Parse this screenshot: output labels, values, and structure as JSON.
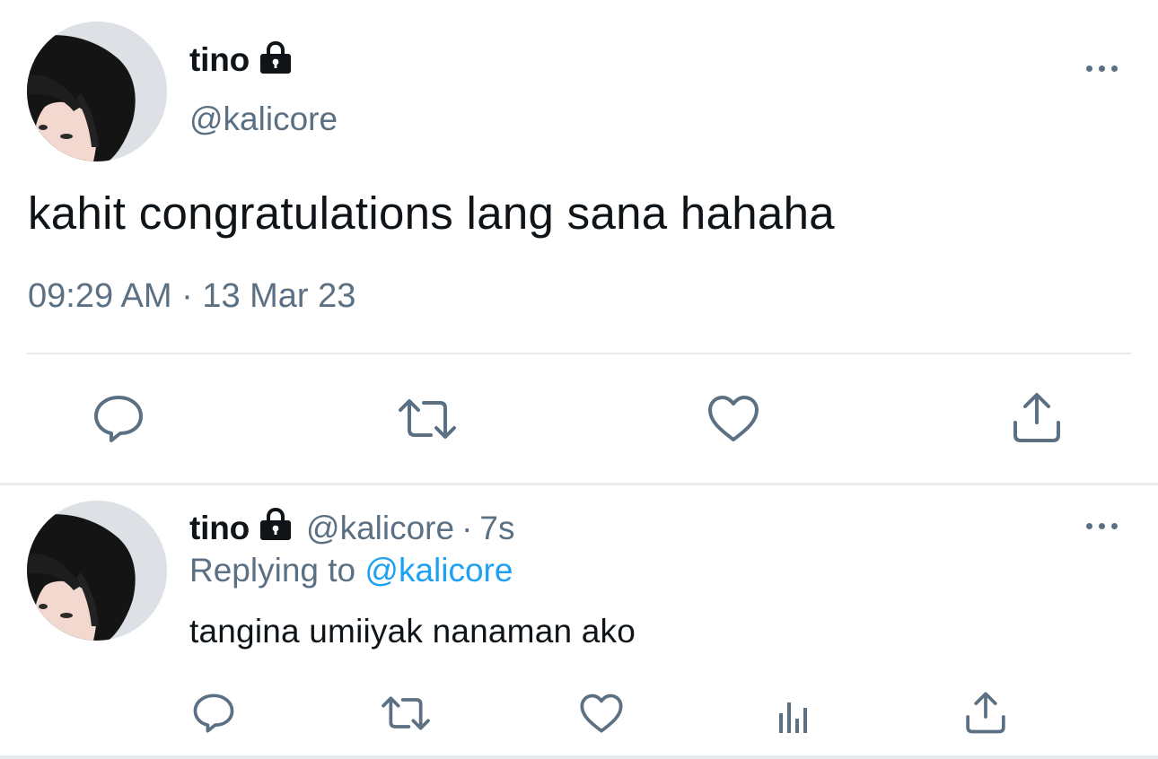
{
  "main_tweet": {
    "display_name": "tino",
    "handle": "@kalicore",
    "text": "kahit congratulations lang sana hahaha",
    "timestamp": "09:29 AM · 13 Mar 23",
    "protected_icon": "lock-icon",
    "more_icon": "more-icon",
    "actions": [
      "reply-icon",
      "retweet-icon",
      "like-icon",
      "share-icon"
    ]
  },
  "reply_tweet": {
    "display_name": "tino",
    "handle": "@kalicore",
    "separator": "·",
    "time_ago": "7s",
    "replying_prefix": "Replying to",
    "replying_to": "@kalicore",
    "text": "tangina umiiyak nanaman ako",
    "protected_icon": "lock-icon",
    "more_icon": "more-icon",
    "actions": [
      "reply-icon",
      "retweet-icon",
      "like-icon",
      "analytics-icon",
      "share-icon"
    ]
  },
  "colors": {
    "text_primary": "#0f1419",
    "text_secondary": "#5b7083",
    "link": "#1da1f2",
    "divider": "#e7ebee",
    "background": "#ffffff"
  }
}
